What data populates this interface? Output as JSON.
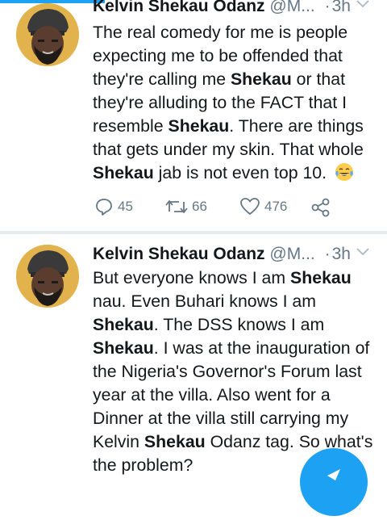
{
  "tweets": [
    {
      "name": "Kelvin Shekau Odanz",
      "handle": "@M...",
      "separator": "·",
      "time": "3h",
      "body_parts": [
        {
          "t": "The real comedy for me is people expecting me to be offended that they're calling me ",
          "b": false
        },
        {
          "t": "Shekau",
          "b": true
        },
        {
          "t": " or that they're alluding to the FACT that I resemble ",
          "b": false
        },
        {
          "t": "Shekau",
          "b": true
        },
        {
          "t": ". There are things that gets under my skin. That whole ",
          "b": false
        },
        {
          "t": "Shekau",
          "b": true
        },
        {
          "t": " jab is not even top 10.",
          "b": false
        }
      ],
      "emoji": "face-with-tears-of-joy",
      "replies": "45",
      "retweets": "66",
      "likes": "476"
    },
    {
      "name": "Kelvin Shekau Odanz",
      "handle": "@M...",
      "separator": "·",
      "time": "3h",
      "body_parts": [
        {
          "t": "But everyone knows I am ",
          "b": false
        },
        {
          "t": "Shekau",
          "b": true
        },
        {
          "t": " nau. Even Buhari knows I am ",
          "b": false
        },
        {
          "t": "Shekau",
          "b": true
        },
        {
          "t": ". The DSS knows I am ",
          "b": false
        },
        {
          "t": "Shekau",
          "b": true
        },
        {
          "t": ". I was at the inauguration of the Nigeria's Governor's Forum last year at the villa. Also went for a Dinner at the villa still carrying my Kelvin ",
          "b": false
        },
        {
          "t": "Shekau",
          "b": true
        },
        {
          "t": " Odanz tag. So what's the problem?",
          "b": false
        }
      ]
    }
  ],
  "colors": {
    "accent": "#1da1f2",
    "muted": "#657786",
    "divider": "#e6ecf0",
    "avatar_bg": "#e0b24a"
  },
  "icons": [
    "reply-icon",
    "retweet-icon",
    "like-icon",
    "share-icon",
    "caret-down-icon",
    "compose-fab"
  ]
}
